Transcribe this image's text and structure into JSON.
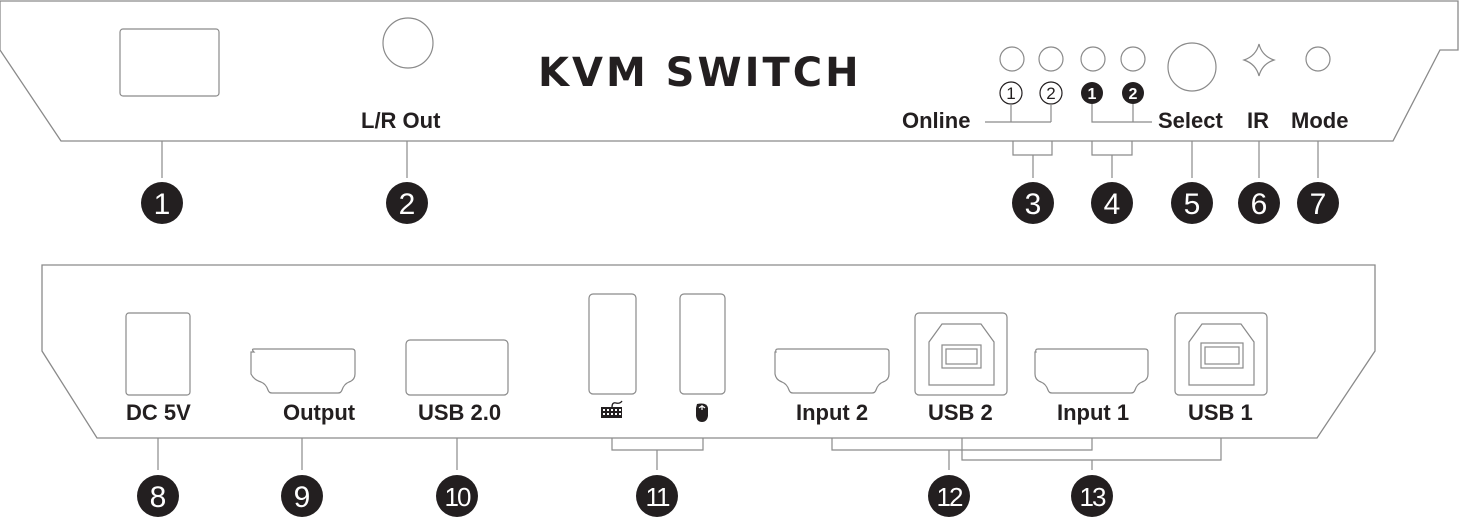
{
  "title": "KVM SWITCH",
  "front_panel": {
    "labels": {
      "lr_out": "L/R Out",
      "online": "Online",
      "select": "Select",
      "ir": "IR",
      "mode": "Mode"
    },
    "online_leds": [
      "1",
      "2"
    ],
    "select_leds": [
      "1",
      "2"
    ]
  },
  "rear_panel": {
    "labels": {
      "dc": "DC 5V",
      "output": "Output",
      "usb20": "USB 2.0",
      "input2": "Input 2",
      "usb2": "USB 2",
      "input1": "Input 1",
      "usb1": "USB 1"
    },
    "icons": [
      "keyboard-icon",
      "mouse-icon"
    ]
  },
  "callouts": [
    "1",
    "2",
    "3",
    "4",
    "5",
    "6",
    "7",
    "8",
    "9",
    "10",
    "11",
    "12",
    "13"
  ],
  "colors": {
    "ink": "#231f20",
    "outline": "#8a8a8a",
    "background": "#ffffff"
  }
}
